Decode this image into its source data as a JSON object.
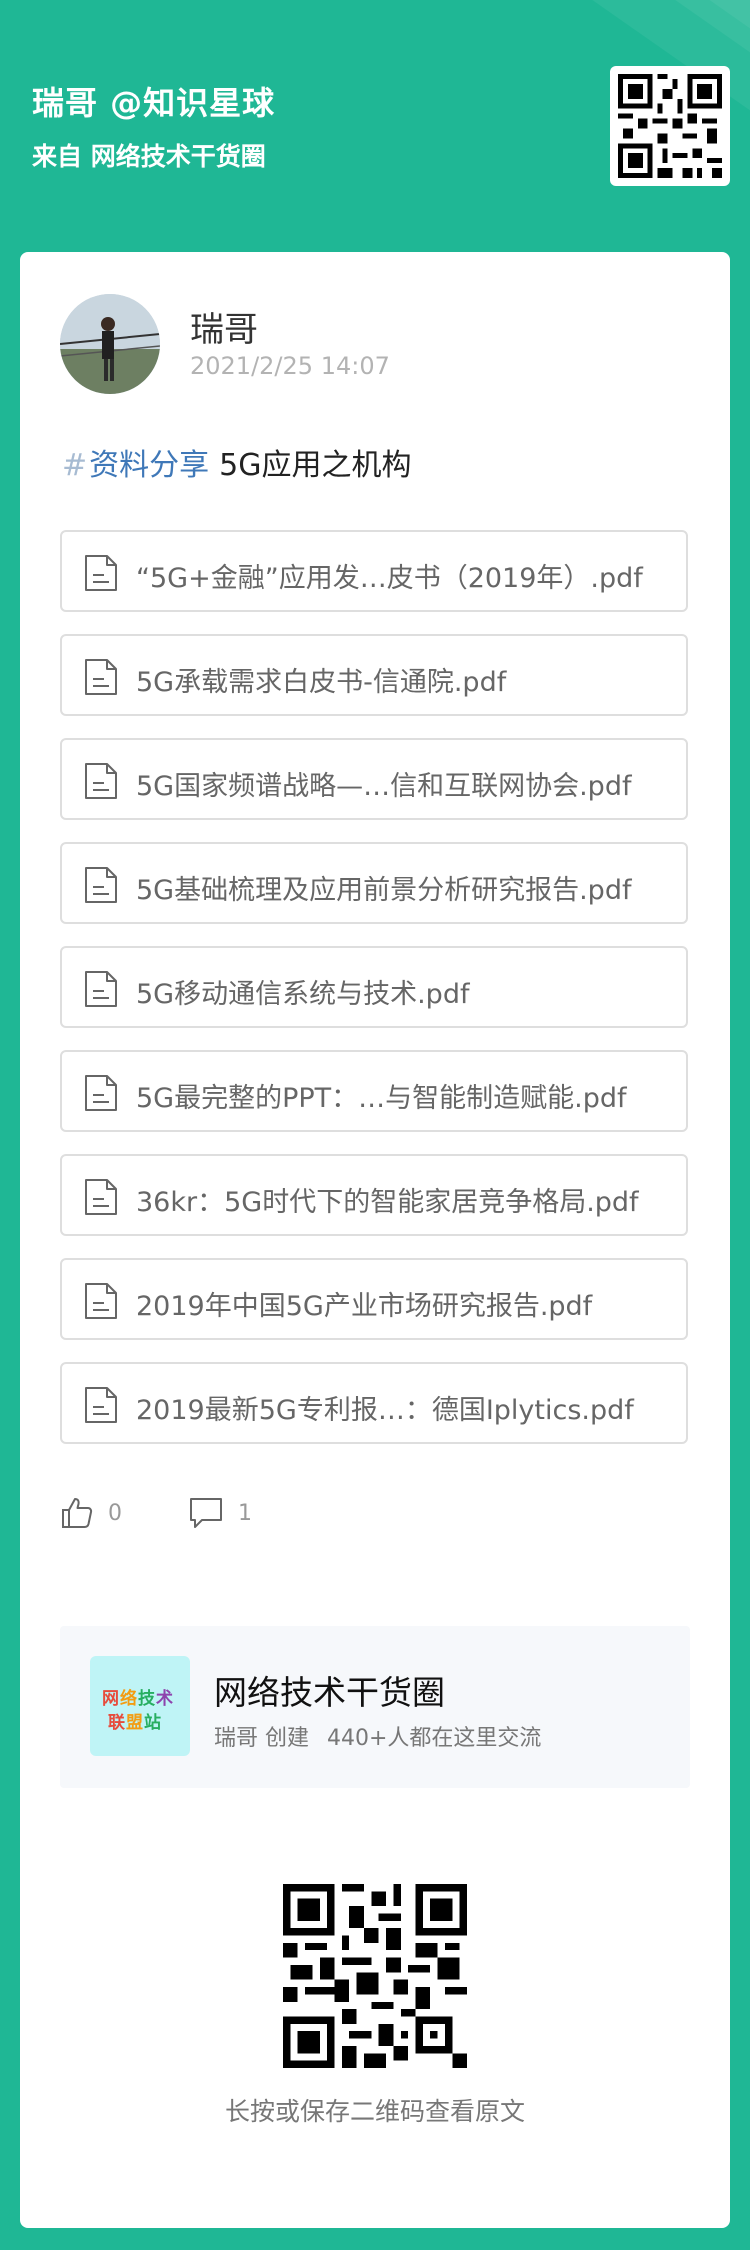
{
  "header": {
    "title": "瑞哥 @知识星球",
    "subtitle": "来自 网络技术干货圈"
  },
  "post": {
    "author": "瑞哥",
    "time": "2021/2/25 14:07",
    "topic_hash": "#",
    "topic_tag": "资料分享",
    "topic_title": "5G应用之机构",
    "files": [
      "“5G+金融”应用发…皮书（2019年）.pdf",
      "5G承载需求白皮书-信通院.pdf",
      "5G国家频谱战略—…信和互联网协会.pdf",
      "5G基础梳理及应用前景分析研究报告.pdf",
      "5G移动通信系统与技术.pdf",
      "5G最完整的PPT：…与智能制造赋能.pdf",
      "36kr：5G时代下的智能家居竞争格局.pdf",
      "2019年中国5G产业市场研究报告.pdf",
      "2019最新5G专利报…：德国Iplytics.pdf"
    ],
    "likes": "0",
    "comments": "1"
  },
  "group": {
    "logo_line1": "网络技术",
    "logo_line2": "联盟站",
    "name": "网络技术干货圈",
    "creator": "瑞哥 创建",
    "members": "440+人都在这里交流"
  },
  "qr_caption": "长按或保存二维码查看原文",
  "colors": {
    "background": "#1fb795",
    "card": "#ffffff",
    "tag": "#3f78b8",
    "hash": "#a7bbd2"
  }
}
